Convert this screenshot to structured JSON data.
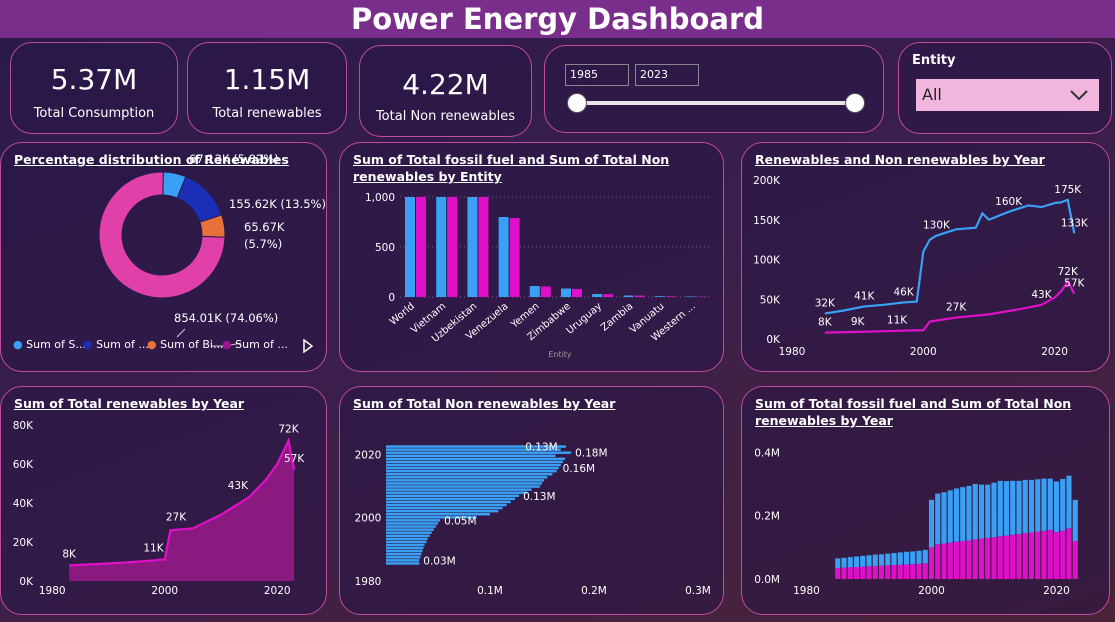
{
  "header": {
    "title": "Power Energy Dashboard"
  },
  "kpis": [
    {
      "value": "5.37M",
      "label": "Total Consumption"
    },
    {
      "value": "1.15M",
      "label": "Total renewables"
    },
    {
      "value": "4.22M",
      "label": "Total Non renewables"
    }
  ],
  "year_slider": {
    "from": "1985",
    "to": "2023"
  },
  "entity_filter": {
    "label": "Entity",
    "selected": "All"
  },
  "colors": {
    "blue": "#3aa0f5",
    "darkblue": "#1a2fb5",
    "orange": "#e8703a",
    "magenta": "#e010c8",
    "pink": "#e040a8",
    "purple": "#9a1690"
  },
  "chart_data": [
    {
      "type": "pie",
      "title": "Percentage distribution of Renewables",
      "slices": [
        {
          "label": "67.13K (5.82%)",
          "value": 67.13
        },
        {
          "label": "155.62K (13.5%)",
          "value": 155.62
        },
        {
          "label_line1": "65.67K",
          "label_line2": "(5.7%)",
          "value": 65.67
        },
        {
          "label": "854.01K (74.06%)",
          "value": 854.01
        }
      ],
      "legend": [
        "Sum of S...",
        "Sum of ...",
        "Sum of Bi...",
        "Sum of ..."
      ],
      "legend_placement": "bottom"
    },
    {
      "type": "bar",
      "title_line1": "Sum of Total fossil fuel and Sum of Total Non",
      "title_line2": "renewables by Entity",
      "categories": [
        "World",
        "Vietnam",
        "Uzbekistan",
        "Venezuela",
        "Yemen",
        "Zimbabwe",
        "Uruguay",
        "Zambia",
        "Vanuatu",
        "Western ..."
      ],
      "series": [
        {
          "values": [
            1000,
            1000,
            1000,
            800,
            110,
            85,
            30,
            15,
            8,
            5
          ]
        },
        {
          "values": [
            1000,
            1000,
            1000,
            790,
            105,
            80,
            28,
            14,
            7,
            4
          ]
        }
      ],
      "y_ticks": [
        "0",
        "500",
        "1,000"
      ],
      "xlabel": "Entity",
      "ylim": [
        0,
        1100
      ]
    },
    {
      "type": "line",
      "title": "Renewables and Non renewables by Year",
      "y_ticks": [
        "0K",
        "50K",
        "100K",
        "150K",
        "200K"
      ],
      "x_ticks": [
        "1980",
        "2000",
        "2020"
      ],
      "ylim": [
        0,
        200000
      ],
      "xlim": [
        1980,
        2026
      ],
      "series": [
        {
          "x": [
            1985,
            1988,
            1991,
            1994,
            1997,
            1999,
            2000,
            2001,
            2002,
            2005,
            2008,
            2009,
            2010,
            2013,
            2016,
            2018,
            2020,
            2021,
            2022,
            2023
          ],
          "y": [
            32000,
            36000,
            41000,
            43000,
            46000,
            47000,
            110000,
            125000,
            130000,
            138000,
            140000,
            158000,
            150000,
            160000,
            168000,
            166000,
            171000,
            172000,
            175000,
            133000
          ]
        },
        {
          "x": [
            1985,
            1990,
            1995,
            1999,
            2000,
            2001,
            2005,
            2010,
            2015,
            2018,
            2020,
            2021,
            2022,
            2023
          ],
          "y": [
            8000,
            9000,
            10000,
            11000,
            11000,
            22000,
            27000,
            31000,
            38000,
            43000,
            52000,
            60000,
            72000,
            57000
          ]
        }
      ],
      "data_labels": [
        {
          "text": "32K",
          "x": 1985,
          "y": 32000
        },
        {
          "text": "41K",
          "x": 1991,
          "y": 41000
        },
        {
          "text": "46K",
          "x": 1997,
          "y": 46000
        },
        {
          "text": "130K",
          "x": 2002,
          "y": 130000
        },
        {
          "text": "160K",
          "x": 2013,
          "y": 160000
        },
        {
          "text": "175K",
          "x": 2022,
          "y": 175000
        },
        {
          "text": "133K",
          "x": 2023,
          "y": 133000
        },
        {
          "text": "8K",
          "x": 1985,
          "y": 8000
        },
        {
          "text": "9K",
          "x": 1990,
          "y": 9000
        },
        {
          "text": "11K",
          "x": 1996,
          "y": 11000
        },
        {
          "text": "27K",
          "x": 2005,
          "y": 27000
        },
        {
          "text": "43K",
          "x": 2018,
          "y": 43000
        },
        {
          "text": "72K",
          "x": 2022,
          "y": 72000
        },
        {
          "text": "57K",
          "x": 2023,
          "y": 57000
        }
      ]
    },
    {
      "type": "area",
      "title": "Sum of Total renewables by Year",
      "y_ticks": [
        "0K",
        "20K",
        "40K",
        "60K",
        "80K"
      ],
      "x_ticks": [
        "1980",
        "2000",
        "2020"
      ],
      "ylim": [
        0,
        80000
      ],
      "xlim": [
        1978,
        2026
      ],
      "x": [
        1983,
        1988,
        1993,
        1998,
        1999,
        2000,
        2001,
        2005,
        2010,
        2015,
        2018,
        2020,
        2021,
        2022,
        2023
      ],
      "y": [
        8000,
        8700,
        9500,
        10500,
        11000,
        11000,
        26000,
        27000,
        34000,
        43000,
        52000,
        60000,
        66000,
        72000,
        57000
      ],
      "data_labels": [
        {
          "text": "8K",
          "x": 1983,
          "y": 8000
        },
        {
          "text": "11K",
          "x": 1998,
          "y": 11000
        },
        {
          "text": "27K",
          "x": 2002,
          "y": 27000
        },
        {
          "text": "43K",
          "x": 2013,
          "y": 43000
        },
        {
          "text": "72K",
          "x": 2022,
          "y": 72000
        },
        {
          "text": "57K",
          "x": 2023,
          "y": 57000
        }
      ]
    },
    {
      "type": "bar",
      "orientation": "horizontal",
      "title": "Sum of Total Non renewables by Year",
      "y_ticks": [
        "2020",
        "2000",
        "1980"
      ],
      "x_ticks": [
        "0.1M",
        "0.2M",
        "0.3M"
      ],
      "xlim": [
        0,
        0.3
      ],
      "years": [
        2023,
        2022,
        2021,
        2020,
        2019,
        2018,
        2017,
        2016,
        2015,
        2014,
        2013,
        2012,
        2011,
        2010,
        2009,
        2008,
        2007,
        2006,
        2005,
        2004,
        2003,
        2002,
        2001,
        2000,
        1999,
        1998,
        1997,
        1996,
        1995,
        1994,
        1993,
        1992,
        1991,
        1990,
        1989,
        1988,
        1987,
        1986,
        1985
      ],
      "values": [
        0.173,
        0.168,
        0.178,
        0.163,
        0.172,
        0.17,
        0.168,
        0.166,
        0.164,
        0.16,
        0.155,
        0.152,
        0.15,
        0.148,
        0.14,
        0.135,
        0.128,
        0.124,
        0.12,
        0.116,
        0.112,
        0.108,
        0.1,
        0.087,
        0.052,
        0.05,
        0.048,
        0.046,
        0.044,
        0.042,
        0.04,
        0.039,
        0.037,
        0.036,
        0.035,
        0.034,
        0.033,
        0.032,
        0.032
      ],
      "data_labels": [
        {
          "text": "0.13M",
          "year": 2023,
          "value": 0.13
        },
        {
          "text": "0.18M",
          "year": 2021,
          "value": 0.178
        },
        {
          "text": "0.16M",
          "year": 2016,
          "value": 0.166
        },
        {
          "text": "0.13M",
          "year": 2007,
          "value": 0.128
        },
        {
          "text": "0.05M",
          "year": 1999,
          "value": 0.052
        },
        {
          "text": "0.03M",
          "year": 1986,
          "value": 0.032
        }
      ]
    },
    {
      "type": "bar",
      "stacked": true,
      "title_line1": "Sum of Total fossil fuel and Sum of Total Non",
      "title_line2": "renewables by Year",
      "y_ticks": [
        "0.0M",
        "0.2M",
        "0.4M"
      ],
      "x_ticks": [
        "1980",
        "2000",
        "2020"
      ],
      "ylim": [
        0,
        0.48
      ],
      "xlim": [
        1978,
        2026
      ],
      "years": [
        1985,
        1986,
        1987,
        1988,
        1989,
        1990,
        1991,
        1992,
        1993,
        1994,
        1995,
        1996,
        1997,
        1998,
        1999,
        2000,
        2001,
        2002,
        2003,
        2004,
        2005,
        2006,
        2007,
        2008,
        2009,
        2010,
        2011,
        2012,
        2013,
        2014,
        2015,
        2016,
        2017,
        2018,
        2019,
        2020,
        2021,
        2022,
        2023
      ],
      "series": [
        {
          "values": [
            0.035,
            0.036,
            0.037,
            0.038,
            0.039,
            0.04,
            0.041,
            0.042,
            0.043,
            0.044,
            0.045,
            0.046,
            0.047,
            0.048,
            0.05,
            0.1,
            0.11,
            0.112,
            0.115,
            0.118,
            0.12,
            0.122,
            0.125,
            0.128,
            0.13,
            0.132,
            0.135,
            0.137,
            0.14,
            0.142,
            0.145,
            0.147,
            0.15,
            0.152,
            0.155,
            0.148,
            0.153,
            0.16,
            0.12
          ]
        },
        {
          "values": [
            0.03,
            0.031,
            0.032,
            0.033,
            0.034,
            0.035,
            0.036,
            0.036,
            0.037,
            0.038,
            0.039,
            0.04,
            0.04,
            0.041,
            0.042,
            0.15,
            0.16,
            0.162,
            0.165,
            0.168,
            0.17,
            0.172,
            0.175,
            0.17,
            0.168,
            0.172,
            0.175,
            0.172,
            0.17,
            0.168,
            0.168,
            0.166,
            0.165,
            0.165,
            0.162,
            0.16,
            0.163,
            0.166,
            0.13
          ]
        }
      ]
    }
  ]
}
